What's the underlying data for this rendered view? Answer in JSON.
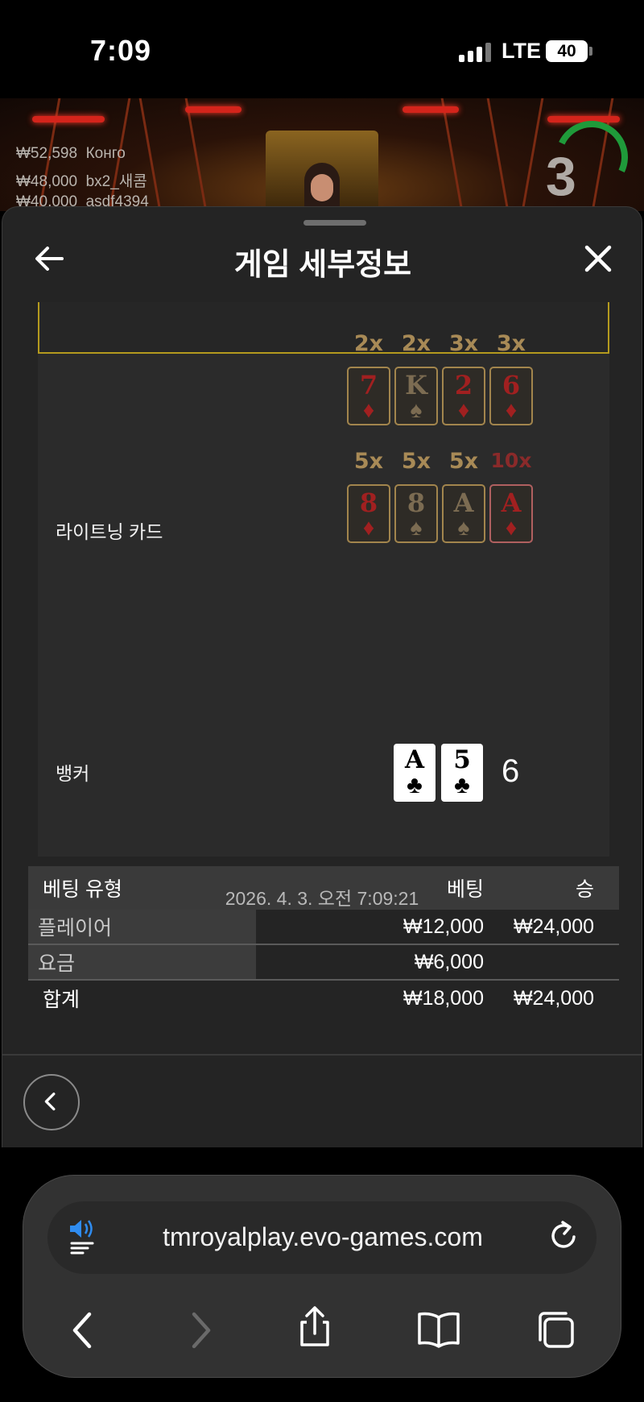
{
  "status_bar": {
    "time": "7:09",
    "network": "LTE",
    "battery": "40"
  },
  "stream": {
    "leaderboard": [
      {
        "amount": "₩52,598",
        "name": "Конго"
      },
      {
        "amount": "₩48,000",
        "name": "bx2_새콤"
      },
      {
        "amount": "₩40,000",
        "name": "asdf4394"
      }
    ],
    "countdown": "3",
    "timer_color": "#1f9a3a"
  },
  "sheet": {
    "title": "게임 세부정보",
    "back_icon": "arrow-left-icon",
    "close_icon": "close-icon",
    "accent_color": "#b49a1e"
  },
  "lightning": {
    "label": "라이트닝 카드",
    "cards": [
      {
        "multiplier": "2x",
        "rank": "7",
        "suit": "♦",
        "color": "red"
      },
      {
        "multiplier": "2x",
        "rank": "K",
        "suit": "♠",
        "color": "dark"
      },
      {
        "multiplier": "3x",
        "rank": "2",
        "suit": "♦",
        "color": "red"
      },
      {
        "multiplier": "3x",
        "rank": "6",
        "suit": "♦",
        "color": "red"
      },
      {
        "multiplier": "5x",
        "rank": "8",
        "suit": "♦",
        "color": "red"
      },
      {
        "multiplier": "5x",
        "rank": "8",
        "suit": "♠",
        "color": "dark"
      },
      {
        "multiplier": "5x",
        "rank": "A",
        "suit": "♠",
        "color": "dark"
      },
      {
        "multiplier": "10x",
        "rank": "A",
        "suit": "♦",
        "color": "red"
      }
    ]
  },
  "banker": {
    "label": "뱅커",
    "cards": [
      {
        "rank": "A",
        "suit": "♣"
      },
      {
        "rank": "5",
        "suit": "♣"
      }
    ],
    "score": "6"
  },
  "bets": {
    "headers": {
      "type": "베팅 유형",
      "bet": "베팅",
      "win": "승"
    },
    "rows": [
      {
        "type": "플레이어",
        "bet": "₩12,000",
        "win": "₩24,000"
      },
      {
        "type": "요금",
        "bet": "₩6,000",
        "win": ""
      }
    ],
    "total": {
      "type": "합계",
      "bet": "₩18,000",
      "win": "₩24,000"
    }
  },
  "footer": {
    "timestamp": "2026. 4. 3. 오전 7:09:21",
    "prev_icon": "chevron-left-icon"
  },
  "browser": {
    "url": "tmroyalplay.evo-games.com",
    "audio_icon": "audio-reader-icon",
    "reload_icon": "reload-icon",
    "toolbar": [
      "back-icon",
      "forward-icon",
      "share-icon",
      "bookmarks-icon",
      "tabs-icon"
    ],
    "accent_color": "#2f8cf0"
  }
}
